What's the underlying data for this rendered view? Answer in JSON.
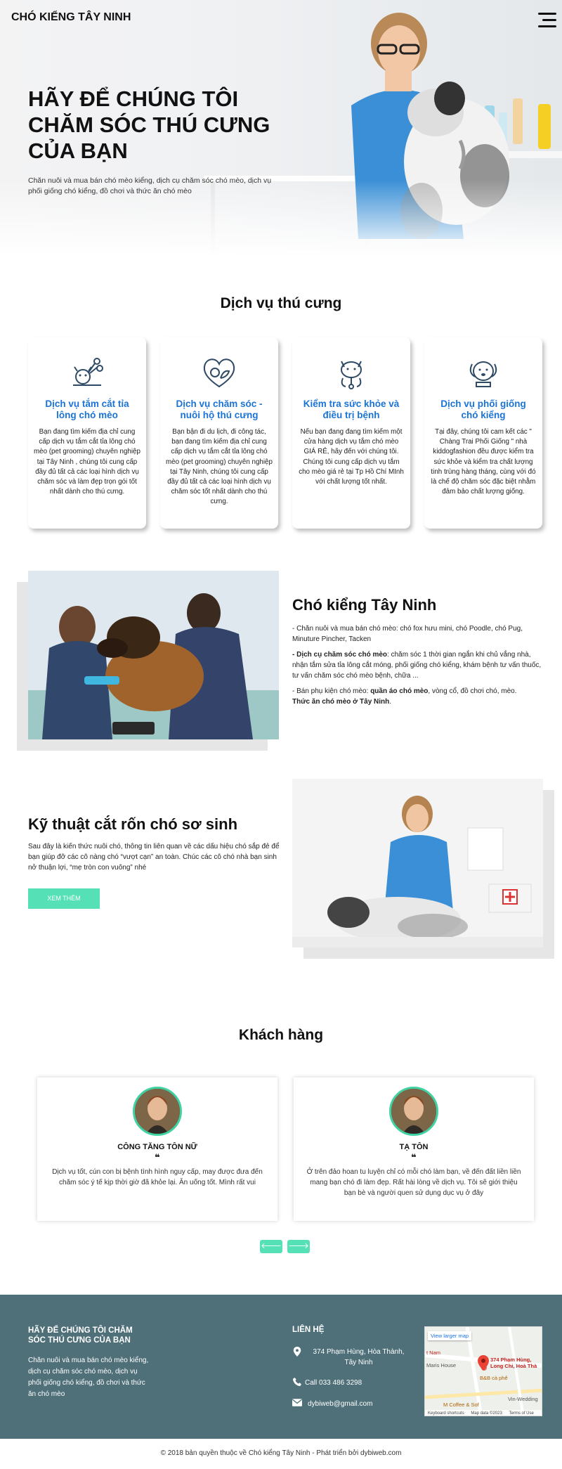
{
  "header": {
    "logo": "CHÓ KIỂNG TÂY NINH",
    "menu_icon": "hamburger-menu-icon"
  },
  "hero": {
    "title": "HÃY ĐỂ CHÚNG TÔI CHĂM SÓC THÚ CƯNG CỦA BẠN",
    "description": "Chăn nuôi và mua bán chó mèo kiểng, dịch cụ chăm sóc chó mèo, dịch vụ phối giống chó kiểng, đồ chơi và thức ăn chó mèo"
  },
  "services": {
    "title": "Dịch vụ thú cưng",
    "items": [
      {
        "icon": "scissors-dog-icon",
        "title": "Dịch vụ tắm cắt tỉa lông chó mèo",
        "text": "Bạn đang tìm kiếm địa chỉ cung cấp dịch vụ tắm cắt tỉa lông chó mèo (pet grooming) chuyên nghiệp tại Tây Ninh , chúng tôi cung cấp đầy đủ tất cả các loại hình dịch vụ chăm sóc và làm đẹp trọn gói tốt nhất dành cho thú cưng."
      },
      {
        "icon": "heart-pets-icon",
        "title": "Dịch vụ chăm sóc - nuôi hộ thú cưng",
        "text": "Bạn bận đi du lịch, đi công tác, bạn đang tìm kiếm địa chỉ cung cấp dịch vụ tắm cắt tỉa lông chó mèo (pet grooming) chuyên nghiệp tại Tây Ninh, chúng tôi cung cấp đầy đủ tất cả các loại hình dịch vụ chăm sóc tốt nhất dành cho thú cưng."
      },
      {
        "icon": "cat-checkup-icon",
        "title": "Kiểm tra sức khỏe và điều trị bệnh",
        "text": "Nếu bạn đang đang tìm kiếm một cửa hàng dịch vụ tắm chó mèo GIÁ RẺ, hãy đến với chúng tôi. Chúng tôi cung cấp dịch vụ tắm cho mèo giá rẻ tại Tp Hồ Chí MInh với chất lượng tốt nhất."
      },
      {
        "icon": "dog-face-icon",
        "title": "Dịch vụ phối giống chó kiểng",
        "text": "Tại đây, chúng tôi cam kết các \" Chàng Trai Phối Giống \" nhà kiddogfashion đều được kiểm tra sức khỏe và kiểm tra chất lượng tinh trùng hàng tháng, cùng với đó là chế độ chăm sóc đặc biệt nhằm đảm bảo chất lượng giống."
      }
    ]
  },
  "about": {
    "title": "Chó kiểng Tây Ninh",
    "p1": "- Chăn nuôi và mua bán chó mèo: chó fox hưu mini, chó Poodle, chó Pug, Minuture Pincher, Tacken",
    "p2_bold": "- Dịch cụ chăm sóc chó mèo",
    "p2_rest": ": chăm sóc 1 thời gian ngắn khi chủ vắng nhà, nhận tắm sửa tỉa lông cắt móng, phối giống chó kiểng, khám bệnh tư vấn thuốc, tư vấn chăm sóc chó mèo bệnh, chữa ...",
    "p3_start": "- Bán phụ kiện chó mèo: ",
    "p3_bold": "quần áo chó mèo",
    "p3_rest": ", vòng cổ, đồ chơi chó, mèo.",
    "p3_bold2": "Thức ăn chó mèo ở Tây Ninh",
    "p3_end": "."
  },
  "technique": {
    "title": "Kỹ thuật cắt rốn chó sơ sinh",
    "description": "Sau đây là kiến thức nuôi chó, thông tin liên quan về các dấu hiệu chó sắp đẻ để bạn giúp đỡ các cô nàng chó “vượt cạn” an toàn. Chúc các cô chó nhà bạn sinh nở thuận lợi, “mẹ tròn con vuông” nhé",
    "button": "XEM THÊM"
  },
  "customers": {
    "title": "Khách hàng",
    "quote_mark": "❝",
    "items": [
      {
        "name": "CÔNG TĂNG TÔN NỮ",
        "text": "Dịch vụ tốt, cún con bị bệnh tình hình nguy cấp, may được đưa đến chăm sóc ý tế kịp thời giờ đã khỏe lại. Ăn uống tốt. Mình rất vui"
      },
      {
        "name": "TẠ TÔN",
        "text": "Ở trên đảo hoan tu luyện chỉ có mỗi chó làm bạn, về đến đất liền liền mang bạn chó đi làm đẹp. Rất hài lòng về dịch vụ. Tôi sẽ giới thiệu bạn bè và người quen sử dụng dục vụ ở đây"
      }
    ],
    "prev": "🡐",
    "next": "🡒"
  },
  "footer": {
    "title": "HÃY ĐỂ CHÚNG TÔI CHĂM SÓC THÚ CƯNG CỦA BẠN",
    "description": "Chăn nuôi và mua bán chó mèo kiểng, dịch cụ chăm sóc chó mèo, dịch vụ phối giống chó kiểng, đồ chơi và thức ăn chó mèo",
    "contact_title": "LIÊN HỆ",
    "address": "374 Phạm Hùng, Hòa Thành, Tây Ninh",
    "phone": "Call 033 486 3298",
    "email": "dybiweb@gmail.com",
    "map": {
      "link": "View larger map",
      "place": "374 Phạm Hùng, Long Chi, Hoà Thà",
      "label_nam": "t Nam",
      "label_maris": "Maris House",
      "label_bb": "B&B cà phê",
      "label_coffee": "M Coffee & Sof",
      "label_vin": "Vin-Wedding",
      "footer_keys": "Keyboard shortcuts",
      "footer_data": "Map data ©2023",
      "footer_terms": "Terms of Use"
    },
    "copyright": "© 2018 bản quyền thuộc về Chó kiểng Tây Ninh - Phát triển bởi dybiweb.com"
  }
}
